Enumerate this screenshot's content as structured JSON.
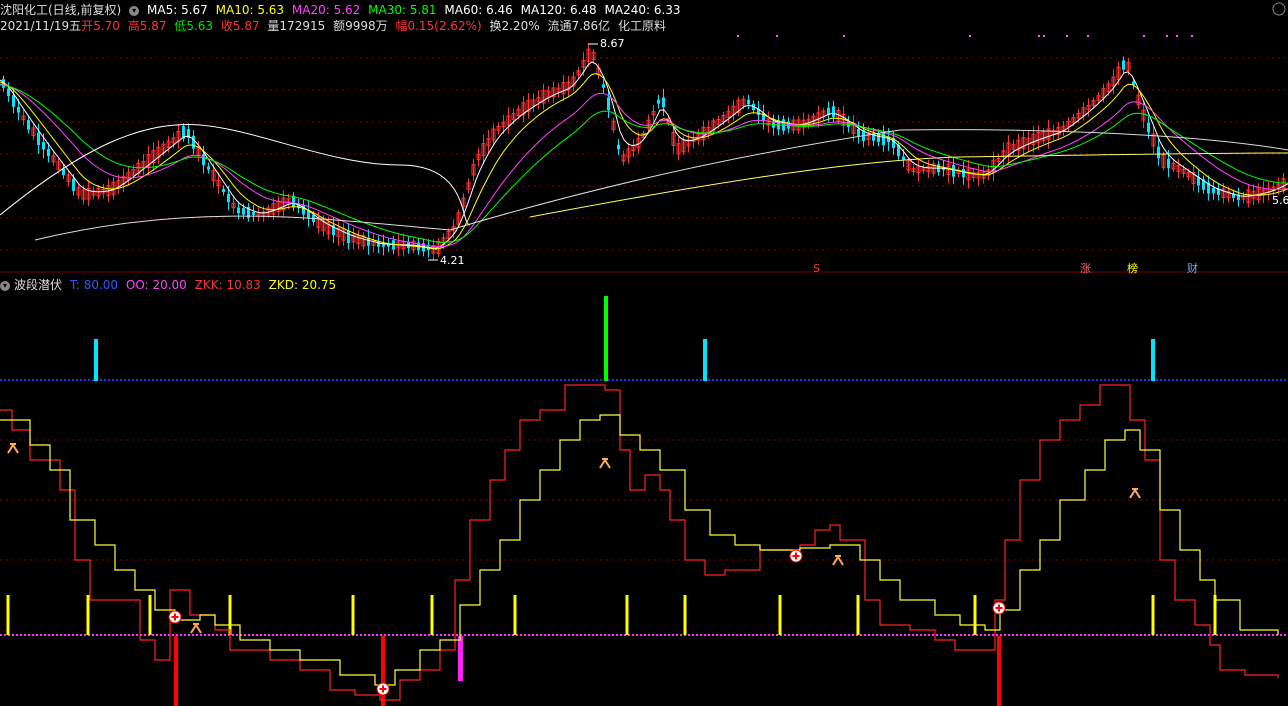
{
  "header": {
    "stock_title": "沈阳化工(日线,前复权)",
    "ma": [
      {
        "label": "MA5: 5.67",
        "color": "#ffffff"
      },
      {
        "label": "MA10: 5.63",
        "color": "#ffff00"
      },
      {
        "label": "MA20: 5.62",
        "color": "#ff44ff"
      },
      {
        "label": "MA30: 5.81",
        "color": "#00ff00"
      },
      {
        "label": "MA60: 6.46",
        "color": "#ffffff"
      },
      {
        "label": "MA120: 6.48",
        "color": "#ffffff"
      },
      {
        "label": "MA240: 6.33",
        "color": "#ffffff"
      }
    ],
    "date": "2021/11/19五",
    "open_label": "开",
    "open": "5.70",
    "high_label": "高",
    "high": "5.87",
    "low_label": "低",
    "low": "5.63",
    "close_label": "收",
    "close": "5.87",
    "volume": "量172915",
    "amount": "额9998万",
    "change_label": "幅",
    "change": "0.15(2.62%)",
    "turnover": "换2.20%",
    "float_cap": "流通7.86亿",
    "sector": "化工原料"
  },
  "price_chart": {
    "max_label": "8.67",
    "min_label": "4.21",
    "right_label": "5.6",
    "markers": [
      {
        "text": "S",
        "color": "#ff3333"
      },
      {
        "text": "涨",
        "color": "#ff6666"
      },
      {
        "text": "榜",
        "color": "#ffff00"
      },
      {
        "text": "财",
        "color": "#66aaff"
      }
    ]
  },
  "indicator": {
    "name": "波段潜伏",
    "params": [
      {
        "label": "T: 80.00",
        "color": "#3355ff"
      },
      {
        "label": "OO: 20.00",
        "color": "#ff44ff"
      },
      {
        "label": "ZKK: 10.83",
        "color": "#ff3333"
      },
      {
        "label": "ZKD: 20.75",
        "color": "#ffff00"
      }
    ]
  },
  "colors": {
    "up": "#ff3333",
    "down": "#00e5ff",
    "grid": "#8b0000",
    "blue_line": "#2233ff",
    "magenta_line": "#ff33ff"
  }
}
